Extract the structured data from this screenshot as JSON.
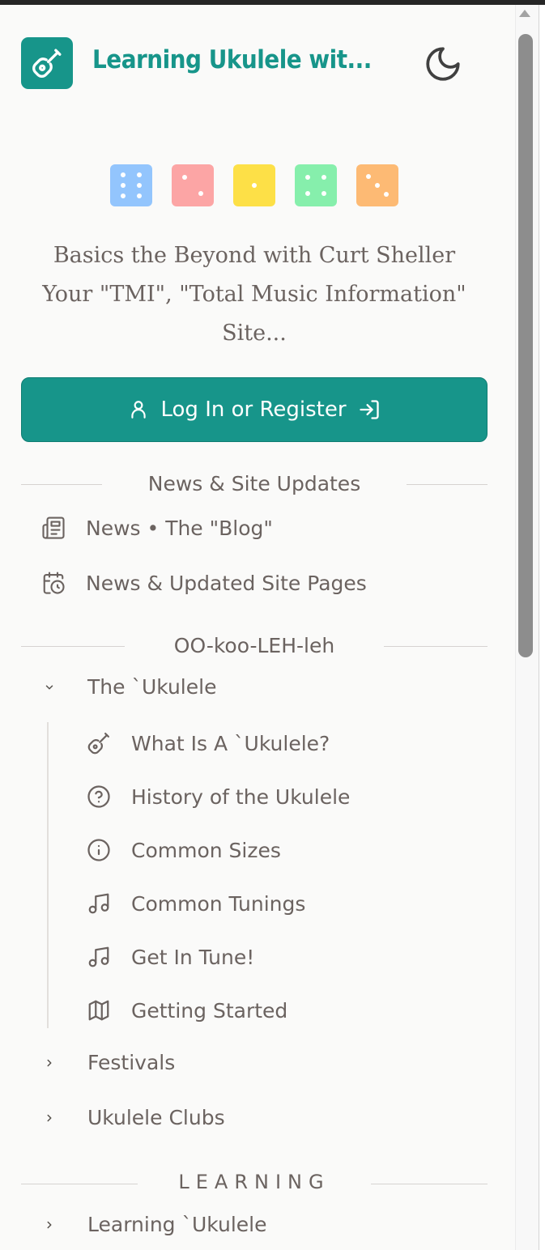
{
  "header": {
    "title": "Learning Ukulele wit...",
    "logo_icon": "ukulele-icon",
    "theme_icon": "moon-icon"
  },
  "dice": [
    {
      "color": "#93c5fd",
      "pips": 6
    },
    {
      "color": "#fca5a5",
      "pips": 2
    },
    {
      "color": "#fde047",
      "pips": 1
    },
    {
      "color": "#86efac",
      "pips": 4
    },
    {
      "color": "#fdba74",
      "pips": 3
    }
  ],
  "tagline": {
    "line1": "Basics the Beyond with Curt Sheller",
    "line2": "Your \"TMI\", \"Total Music Information\"",
    "line3": "Site..."
  },
  "login": {
    "label": "Log In or Register"
  },
  "sections": {
    "news": "News & Site Updates",
    "ookoo": "OO-koo-LEH-leh",
    "learning": "LEARNING"
  },
  "news_items": [
    {
      "label": "News • The \"Blog\"",
      "icon": "newspaper-icon"
    },
    {
      "label": "News & Updated Site Pages",
      "icon": "calendar-clock-icon"
    }
  ],
  "ukulele_group": {
    "label": "The `Ukulele",
    "expanded": true
  },
  "ukulele_items": [
    {
      "label": "What Is A `Ukulele?",
      "icon": "ukulele-icon"
    },
    {
      "label": "History of the Ukulele",
      "icon": "question-circle-icon"
    },
    {
      "label": "Common Sizes",
      "icon": "info-circle-icon"
    },
    {
      "label": "Common Tunings",
      "icon": "music-note-icon"
    },
    {
      "label": "Get In Tune!",
      "icon": "music-note-icon"
    },
    {
      "label": "Getting Started",
      "icon": "map-icon"
    }
  ],
  "collapsed_groups": [
    {
      "label": "Festivals"
    },
    {
      "label": "Ukulele Clubs"
    }
  ],
  "learning_items": [
    {
      "label": "Learning `Ukulele"
    }
  ],
  "colors": {
    "accent": "#17958a",
    "text": "#6b6360",
    "background": "#fafaf9"
  }
}
